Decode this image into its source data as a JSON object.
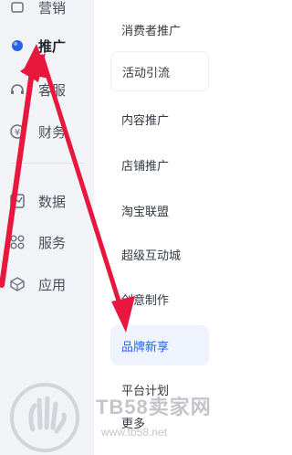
{
  "sidebar": {
    "items": [
      {
        "label": "营销",
        "icon": "marketing-icon",
        "active": false
      },
      {
        "label": "推广",
        "icon": "promotion-dot-icon",
        "active": true
      },
      {
        "label": "客服",
        "icon": "headset-icon",
        "active": false
      },
      {
        "label": "财务",
        "icon": "yen-icon",
        "active": false
      },
      {
        "label": "数据",
        "icon": "chart-icon",
        "active": false
      },
      {
        "label": "服务",
        "icon": "grid-icon",
        "active": false
      },
      {
        "label": "应用",
        "icon": "cube-icon",
        "active": false
      }
    ]
  },
  "submenu": {
    "items": [
      {
        "label": "消费者推广"
      },
      {
        "label": "活动引流"
      },
      {
        "label": "内容推广"
      },
      {
        "label": "店铺推广"
      },
      {
        "label": "淘宝联盟"
      },
      {
        "label": "超级互动城"
      },
      {
        "label": "创意制作"
      },
      {
        "label": "品牌新享"
      },
      {
        "label": "平台计划"
      },
      {
        "label": "更多"
      }
    ]
  },
  "watermark": {
    "brand": "TB58卖家网",
    "url": "www.tb58.net"
  },
  "colors": {
    "accent": "#2a62e6",
    "arrow": "#e8173e",
    "sidebar_bg": "#f1f3f7",
    "active_bg": "#eef3fd"
  }
}
